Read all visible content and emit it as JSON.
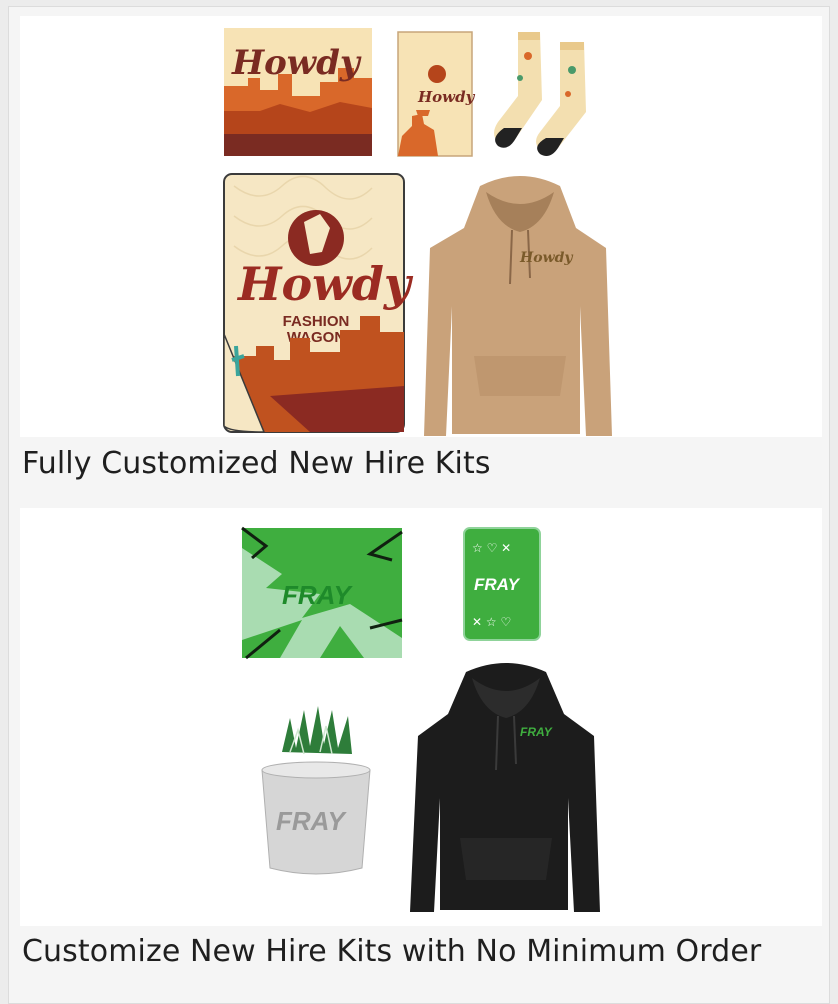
{
  "cards": [
    {
      "caption": "Fully Customized New Hire Kits",
      "items": [
        "notebook",
        "card",
        "socks",
        "blanket",
        "hoodie"
      ],
      "brand": {
        "word": "Howdy",
        "blanket_sub1": "FASHION",
        "blanket_sub2": "WAGON",
        "colors": {
          "cream": "#f6e7c4",
          "rust": "#b5451b",
          "maroon": "#7a2b22",
          "tan": "#c9a27a"
        }
      }
    },
    {
      "caption": "Customize New Hire Kits with No Minimum Order",
      "items": [
        "notebook",
        "card",
        "planter",
        "hoodie"
      ],
      "brand": {
        "word": "FRAY",
        "colors": {
          "green": "#3fae3f",
          "mint": "#a9dcb1",
          "black": "#1c1c1c",
          "concrete": "#d6d6d6"
        }
      }
    }
  ]
}
